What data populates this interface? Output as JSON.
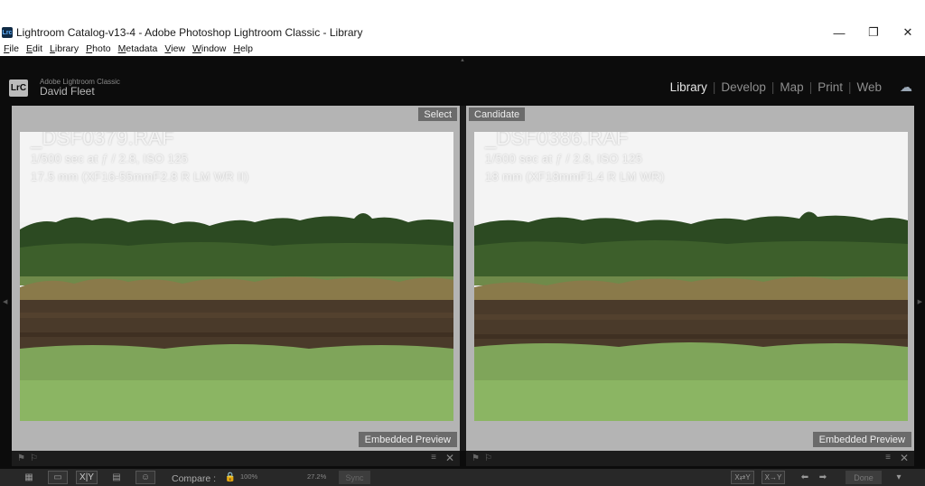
{
  "window": {
    "title": "Lightroom Catalog-v13-4 - Adobe Photoshop Lightroom Classic - Library",
    "app_icon": "Lrc",
    "controls": {
      "minimize": "—",
      "restore": "❐",
      "close": "✕"
    }
  },
  "menu": [
    "File",
    "Edit",
    "Library",
    "Photo",
    "Metadata",
    "View",
    "Window",
    "Help"
  ],
  "identity": {
    "logo": "LrC",
    "brand": "Adobe Lightroom Classic",
    "user": "David Fleet"
  },
  "modules": [
    "Library",
    "Develop",
    "Map",
    "Print",
    "Web"
  ],
  "active_module": "Library",
  "panes": {
    "select": {
      "tag": "Select",
      "filename": "_DSF0379.RAF",
      "exposure": "1/500 sec at ƒ / 2.8, ISO 125",
      "lens": "17.5 mm (XF16-55mmF2.8 R LM WR II)",
      "badge": "Embedded Preview"
    },
    "candidate": {
      "tag": "Candidate",
      "filename": "_DSF0386.RAF",
      "exposure": "1/500 sec at ƒ / 2.8, ISO 125",
      "lens": "18 mm (XF18mmF1.4 R LM WR)",
      "badge": "Embedded Preview"
    }
  },
  "toolbar": {
    "grid_icon": "grid-view-icon",
    "xy_label": "X|Y",
    "compare_label": "Compare :",
    "zoom_left": "100%",
    "zoom_right": "27.2%",
    "sync_label": "Sync",
    "swap_label": "X⇄Y",
    "make_select_label": "X→Y",
    "done_label": "Done"
  }
}
